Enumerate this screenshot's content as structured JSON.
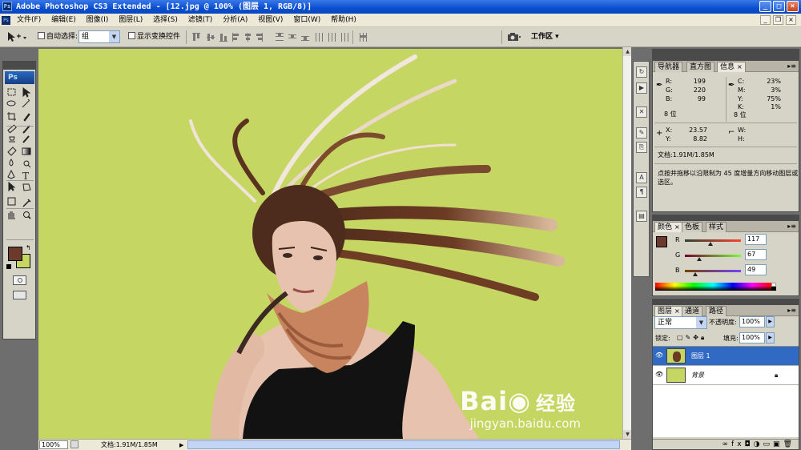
{
  "window": {
    "title": "Adobe Photoshop CS3 Extended - [12.jpg @ 100% (图层 1, RGB/8)]",
    "app_icon": "Ps",
    "controls": [
      "_",
      "□",
      "×"
    ]
  },
  "menubar": {
    "items": [
      "文件(F)",
      "编辑(E)",
      "图像(I)",
      "图层(L)",
      "选择(S)",
      "滤镜(T)",
      "分析(A)",
      "视图(V)",
      "窗口(W)",
      "帮助(H)"
    ],
    "doc_controls": [
      "_",
      "❐",
      "×"
    ]
  },
  "options_bar": {
    "auto_select_label": "自动选择:",
    "auto_select_value": "组",
    "show_transform_label": "显示变换控件",
    "workspace_label": "工作区 ▾"
  },
  "toolbox": {
    "logo": "Ps",
    "foreground_color": "#6b3a2c",
    "background_color": "#c5d663"
  },
  "document": {
    "zoom": "100%",
    "doc_size": "文档:1.91M/1.85M",
    "canvas_color": "#c5d663"
  },
  "info_panel": {
    "tabs": [
      "导航器",
      "直方图",
      "信息"
    ],
    "active_tab": "信息",
    "rgb": {
      "r_label": "R:",
      "r": "199",
      "g_label": "G:",
      "g": "220",
      "b_label": "B:",
      "b": "99"
    },
    "cmyk": {
      "c_label": "C:",
      "c": "23%",
      "m_label": "M:",
      "m": "3%",
      "y_label": "Y:",
      "y": "75%",
      "k_label": "K:",
      "k": "1%"
    },
    "bit_left": "8 位",
    "bit_right": "8 位",
    "coords": {
      "x_label": "X:",
      "x": "23.57",
      "y_label": "Y:",
      "y": "8.82"
    },
    "size": {
      "w_label": "W:",
      "h_label": "H:"
    },
    "doc_size": "文档:1.91M/1.85M",
    "hint": "点按并拖移以沿限制为 45 度增量方向移动图层或选区。"
  },
  "color_panel": {
    "tabs": [
      "颜色",
      "色板",
      "样式"
    ],
    "active_tab": "颜色",
    "labels": [
      "R",
      "G",
      "B"
    ],
    "values": [
      "117",
      "67",
      "49"
    ],
    "fractions": [
      0.459,
      0.263,
      0.192
    ]
  },
  "layers_panel": {
    "tabs": [
      "图层",
      "通道",
      "路径"
    ],
    "active_tab": "图层",
    "blend_mode": "正常",
    "opacity_label": "不透明度:",
    "opacity": "100%",
    "lock_label": "锁定:",
    "fill_label": "填充:",
    "fill": "100%",
    "layers": [
      {
        "name": "图层 1",
        "selected": true
      },
      {
        "name": "背景",
        "selected": false,
        "locked": true
      }
    ]
  },
  "watermark": {
    "brand": "Bai",
    "brand2": "经验",
    "url": "jingyan.baidu.com"
  }
}
